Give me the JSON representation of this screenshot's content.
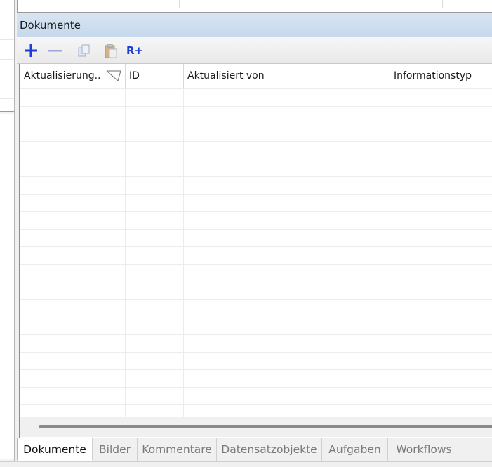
{
  "panel": {
    "title": "Dokumente"
  },
  "toolbar": {
    "buttons": [
      {
        "icon": "plus-icon"
      },
      {
        "icon": "minus-icon"
      },
      {
        "icon": "copy-icon"
      },
      {
        "icon": "paste-icon"
      },
      {
        "icon": "add-relation-icon",
        "label": "R+"
      }
    ]
  },
  "grid": {
    "columns": [
      {
        "label": "Aktualisierung..."
      },
      {
        "label": "ID"
      },
      {
        "label": "Aktualisiert von"
      },
      {
        "label": "Informationstyp"
      }
    ],
    "sorted_column_icon": "sort-indicator-icon",
    "rows": []
  },
  "tabs": [
    {
      "label": "Dokumente",
      "active": true
    },
    {
      "label": "Bilder"
    },
    {
      "label": "Kommentare"
    },
    {
      "label": "Datensatzobjekte"
    },
    {
      "label": "Aufgaben"
    },
    {
      "label": "Workflows"
    }
  ],
  "colors": {
    "header_gradient_top": "#d8e5f2",
    "header_gradient_bottom": "#c6d8ec",
    "toolbar_blue": "#1d3dd8"
  }
}
